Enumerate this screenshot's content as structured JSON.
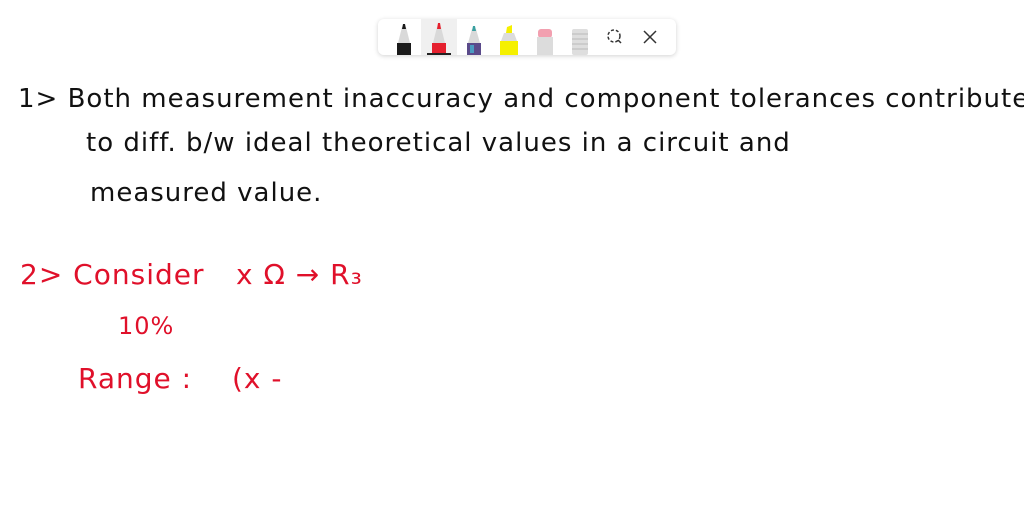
{
  "toolbar": {
    "tools": [
      {
        "name": "black-pen",
        "color": "#1a1a1a",
        "selected": false
      },
      {
        "name": "red-pen",
        "color": "#e5202e",
        "selected": true
      },
      {
        "name": "galaxy-pen",
        "color": "#5a4a8a",
        "selected": false
      },
      {
        "name": "yellow-highlighter",
        "color": "#f5f000",
        "selected": false
      },
      {
        "name": "eraser",
        "color": "#f2a0b0",
        "selected": false
      },
      {
        "name": "ruler",
        "color": "#d8d8d8",
        "selected": false
      }
    ],
    "lasso_icon": "lasso-select-icon",
    "close_icon": "close-icon"
  },
  "notes": {
    "point1": {
      "line1": "1> Both measurement inaccuracy and component tolerances contribute",
      "line2": "to diff. b/w ideal theoretical values in a circuit and",
      "line3": "measured value."
    },
    "point2": {
      "line1_label": "2> Consider",
      "line1_expr": "x Ω → R₃",
      "line2": "10%",
      "line3_label": "Range :",
      "line3_expr": "(x -"
    }
  }
}
